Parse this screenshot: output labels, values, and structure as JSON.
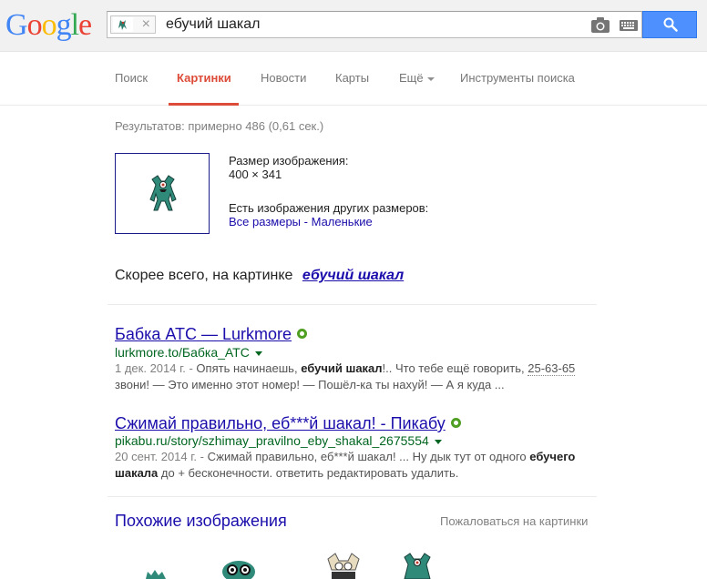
{
  "header": {
    "logo_letters": [
      {
        "char": "G",
        "color": "#4285f4"
      },
      {
        "char": "o",
        "color": "#ea4335"
      },
      {
        "char": "o",
        "color": "#fbbc05"
      },
      {
        "char": "g",
        "color": "#4285f4"
      },
      {
        "char": "l",
        "color": "#34a853"
      },
      {
        "char": "e",
        "color": "#ea4335"
      }
    ],
    "search_query": "ебучий шакал",
    "image_chip_close": "×",
    "camera_icon": "camera-icon",
    "keyboard_icon": "keyboard-icon",
    "search_icon": "search-icon",
    "accent_color": "#4d90fe"
  },
  "tabs": [
    {
      "label": "Поиск",
      "active": false
    },
    {
      "label": "Картинки",
      "active": true
    },
    {
      "label": "Новости",
      "active": false
    },
    {
      "label": "Карты",
      "active": false
    },
    {
      "label": "Ещё",
      "active": false
    },
    {
      "label": "Инструменты поиска",
      "active": false
    }
  ],
  "stats": "Результатов: примерно 486 (0,61 сек.)",
  "image_info": {
    "size_label": "Размер изображения:",
    "size_value": "400 × 341",
    "other_sizes_label": "Есть изображения других размеров:",
    "all_sizes": "Все размеры",
    "separator": " - ",
    "small": "Маленькие"
  },
  "best_guess": {
    "prefix": "Скорее всего, на картинке",
    "query": "ебучий шакал"
  },
  "results": [
    {
      "title": "Бабка АТС — Lurkmore",
      "url": "lurkmore.to/Бабка_АТС",
      "date": "1 дек. 2014 г. - ",
      "snippet_a": "Опять начинаешь, ",
      "snippet_b": "ебучий шакал",
      "snippet_c": "!.. Что тебе ещё говорить, ",
      "snippet_phone": "25-63-65",
      "snippet_line2": "звони! — Это именно этот номер! — Пошёл-ка ты нахуй! — А я куда ..."
    },
    {
      "title": "Сжимай правильно, еб***й шакал! - Пикабу",
      "url": "pikabu.ru/story/szhimay_pravilno_eby_shakal_2675554",
      "date": "20 сент. 2014 г. - ",
      "snippet_a": "Сжимай правильно, еб***й шакал! ... Ну дык тут от одного ",
      "snippet_b": "ебучего",
      "snippet_line2_b": "шакала",
      "snippet_line2_c": " до + бесконечности. ответить редактировать удалить."
    }
  ],
  "similar": {
    "title": "Похожие изображения",
    "report": "Пожаловаться на картинки"
  }
}
